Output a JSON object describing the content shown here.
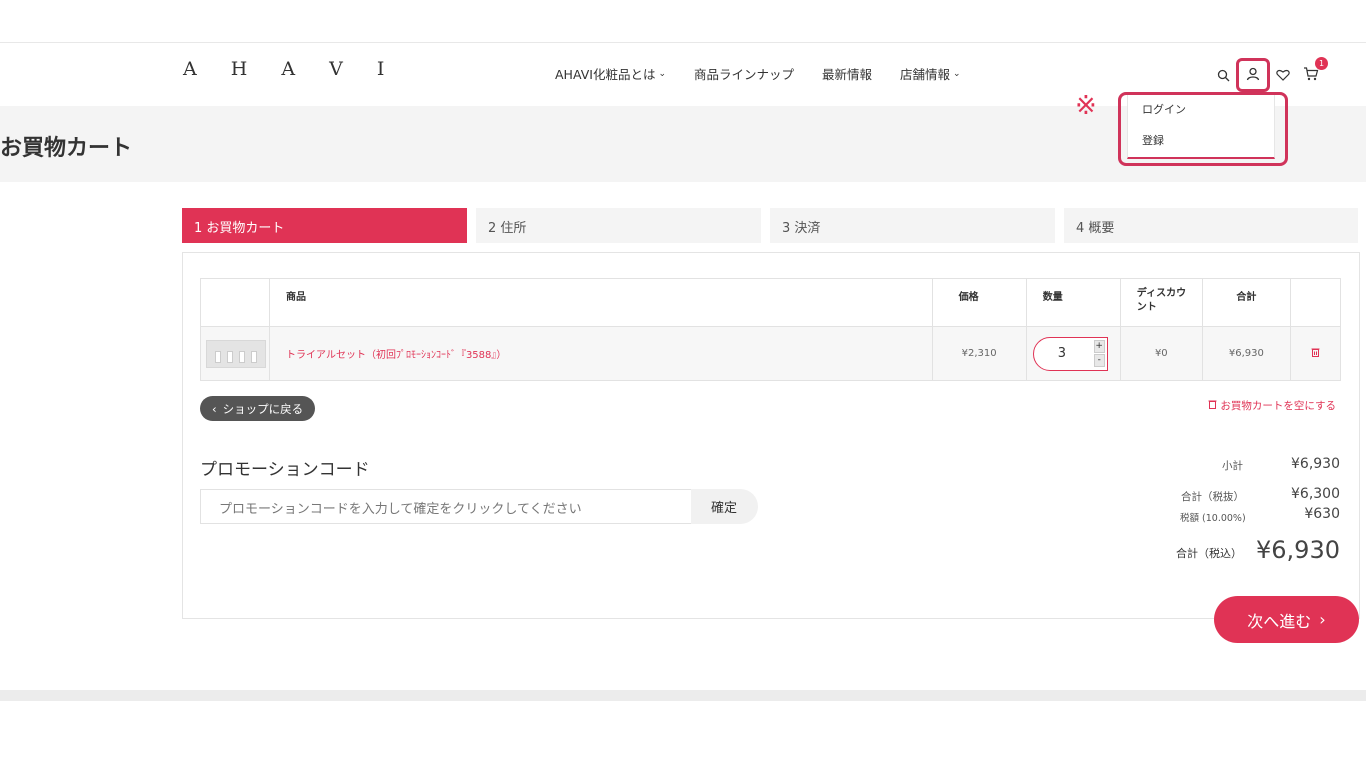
{
  "header": {
    "logo": "A H A V I",
    "nav": [
      {
        "label": "AHAVI化粧品とは",
        "chevron": "⌄"
      },
      {
        "label": "商品ラインナップ",
        "chevron": ""
      },
      {
        "label": "最新情報",
        "chevron": ""
      },
      {
        "label": "店舗情報",
        "chevron": "⌄"
      }
    ],
    "cart_count": "1",
    "icons": [
      "search-icon",
      "user-icon",
      "heart-icon",
      "cart-icon"
    ]
  },
  "account_menu": {
    "items": [
      "ログイン",
      "登録"
    ],
    "note_mark": "※"
  },
  "page": {
    "title": "お買物カート"
  },
  "steps": [
    {
      "label": "1  お買物カート",
      "active": true
    },
    {
      "label": "2  住所",
      "active": false
    },
    {
      "label": "3  決済",
      "active": false
    },
    {
      "label": "4  概要",
      "active": false
    }
  ],
  "table": {
    "headers": [
      "商品",
      "価格",
      "数量",
      "ディスカウント",
      "合計"
    ],
    "rows": [
      {
        "product": "トライアルセット（初回ﾌﾟﾛﾓｰｼｮﾝｺｰﾄﾞ『3588』）",
        "price": "¥2,310",
        "quantity": "3",
        "discount": "¥0",
        "total": "¥6,930"
      }
    ]
  },
  "actions": {
    "back_label": "ショップに戻る",
    "empty_cart_label": "お買物カートを空にする",
    "next_label": "次へ進む",
    "qty_plus": "+",
    "qty_minus": "-"
  },
  "promo": {
    "title": "プロモーションコード",
    "placeholder": "プロモーションコードを入力して確定をクリックしてください",
    "confirm_label": "確定"
  },
  "summary": {
    "subtotal_label": "小計",
    "subtotal": "¥6,930",
    "total_excl_label": "合計（税抜）",
    "total_excl": "¥6,300",
    "tax_label": "税額 (10.00%)",
    "tax": "¥630",
    "grand_label": "合計（税込）",
    "grand": "¥6,930"
  },
  "colors": {
    "accent": "#e03355",
    "highlight_border": "#d0335a"
  }
}
